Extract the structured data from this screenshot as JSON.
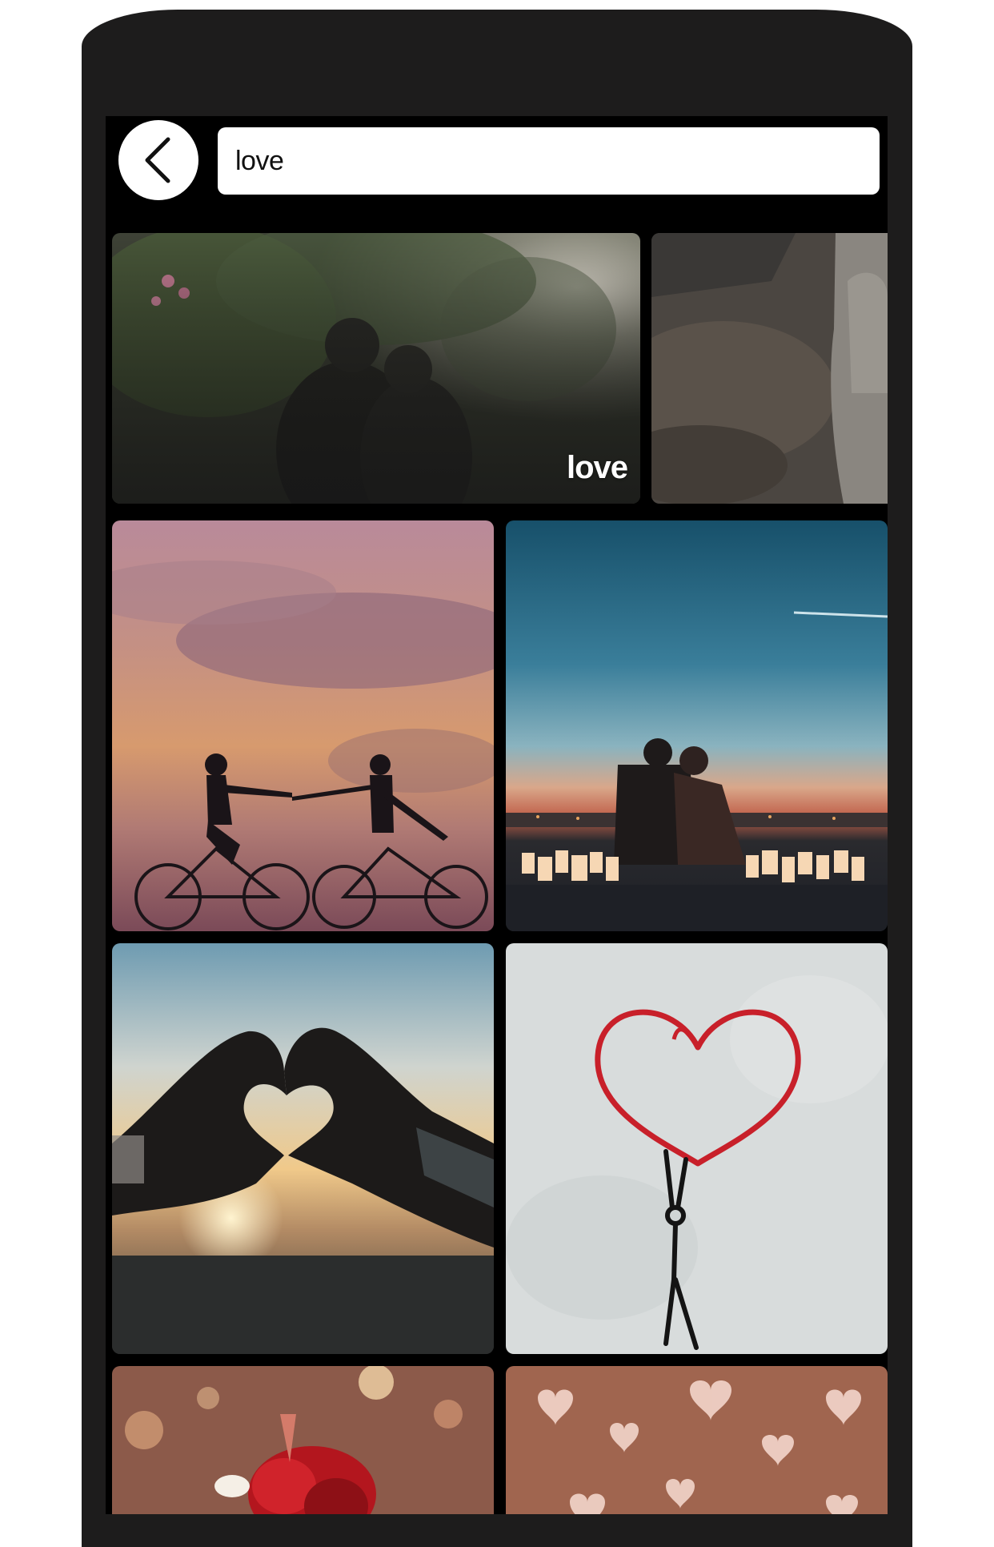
{
  "search": {
    "query": "love"
  },
  "categories": [
    {
      "label": "love"
    }
  ],
  "results": [
    {
      "icon": "couple-kissing-under-tree"
    },
    {
      "icon": "rocky-shore-person"
    },
    {
      "icon": "couple-on-bicycles-sunset"
    },
    {
      "icon": "couple-sitting-candles-city"
    },
    {
      "icon": "hands-heart-sunset"
    },
    {
      "icon": "heart-balloon-graffiti"
    },
    {
      "icon": "red-rose-bokeh"
    },
    {
      "icon": "heart-bokeh-lights"
    }
  ]
}
